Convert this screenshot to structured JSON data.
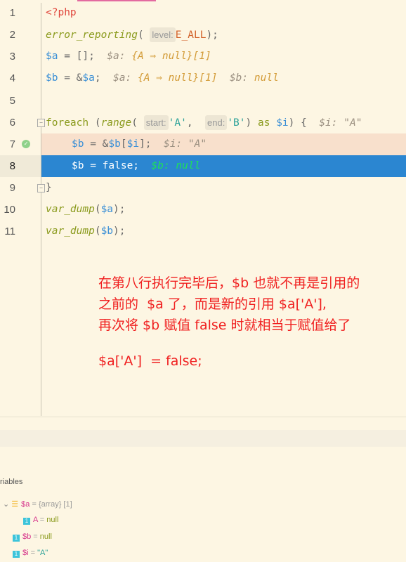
{
  "editor": {
    "line_numbers": [
      "1",
      "2",
      "3",
      "4",
      "5",
      "6",
      "7",
      "8",
      "9",
      "10",
      "11"
    ],
    "lines": {
      "l1": {
        "tag": "<?php"
      },
      "l2": {
        "fn": "error_reporting",
        "p1": "(",
        "hint": "level:",
        "const": "E_ALL",
        "p2": ");"
      },
      "l3": {
        "code": "$a",
        "rest": " = [];  ",
        "dbg": "$a: ",
        "dbgv": "{A ⇒ null}[1]"
      },
      "l4": {
        "code": "$b",
        "rest": " = &",
        "v2": "$a",
        "rest2": ";  ",
        "dbg": "$a: ",
        "dbgv": "{A ⇒ null}[1]",
        "dbg2": "  $b: ",
        "dbgv2": "null"
      },
      "l6": {
        "kw": "foreach",
        "p1": " (",
        "fn": "range",
        "p2": "(",
        "hint1": "start:",
        "s1": "'A'",
        "p3": ",  ",
        "hint2": "end:",
        "s2": "'B'",
        "p4": ") ",
        "as": "as",
        "v": " $i",
        "p5": ") {  ",
        "dbg": "$i: \"A\""
      },
      "l7": {
        "v1": "$b",
        "rest": " = &",
        "v2": "$b",
        "p": "[",
        "v3": "$i",
        "p2": "];  ",
        "dbg": "$i: \"A\""
      },
      "l8": {
        "code": "$b = false;  ",
        "dbg": "$b: null"
      },
      "l9": {
        "code": "}"
      },
      "l10": {
        "fn": "var_dump",
        "p1": "(",
        "v": "$a",
        "p2": ");"
      },
      "l11": {
        "fn": "var_dump",
        "p1": "(",
        "v": "$b",
        "p2": ");"
      }
    }
  },
  "annotation": {
    "line1": "在第八行执行完毕后，$b 也就不再是引用的",
    "line2": "之前的  $a 了，而是新的引用 $a['A'],",
    "line3": "再次将 $b 赋值 false 时就相当于赋值给了",
    "line4": "$a['A']  = false;"
  },
  "variables": {
    "title": "riables",
    "items": [
      {
        "name": "$a",
        "eq": " = ",
        "value": "{array} [1]",
        "type": "array"
      },
      {
        "name": "A",
        "eq": " = ",
        "value": "null",
        "type": "1"
      },
      {
        "name": "$b",
        "eq": " = ",
        "value": "null",
        "type": "1"
      },
      {
        "name": "$i",
        "eq": " = ",
        "value": "\"A\"",
        "type": "1"
      }
    ]
  },
  "colors": {
    "background": "#fdf6e3",
    "current_line": "#2b86d1",
    "breakpoint_line": "#f8e0cc",
    "annotation": "#f02020"
  }
}
